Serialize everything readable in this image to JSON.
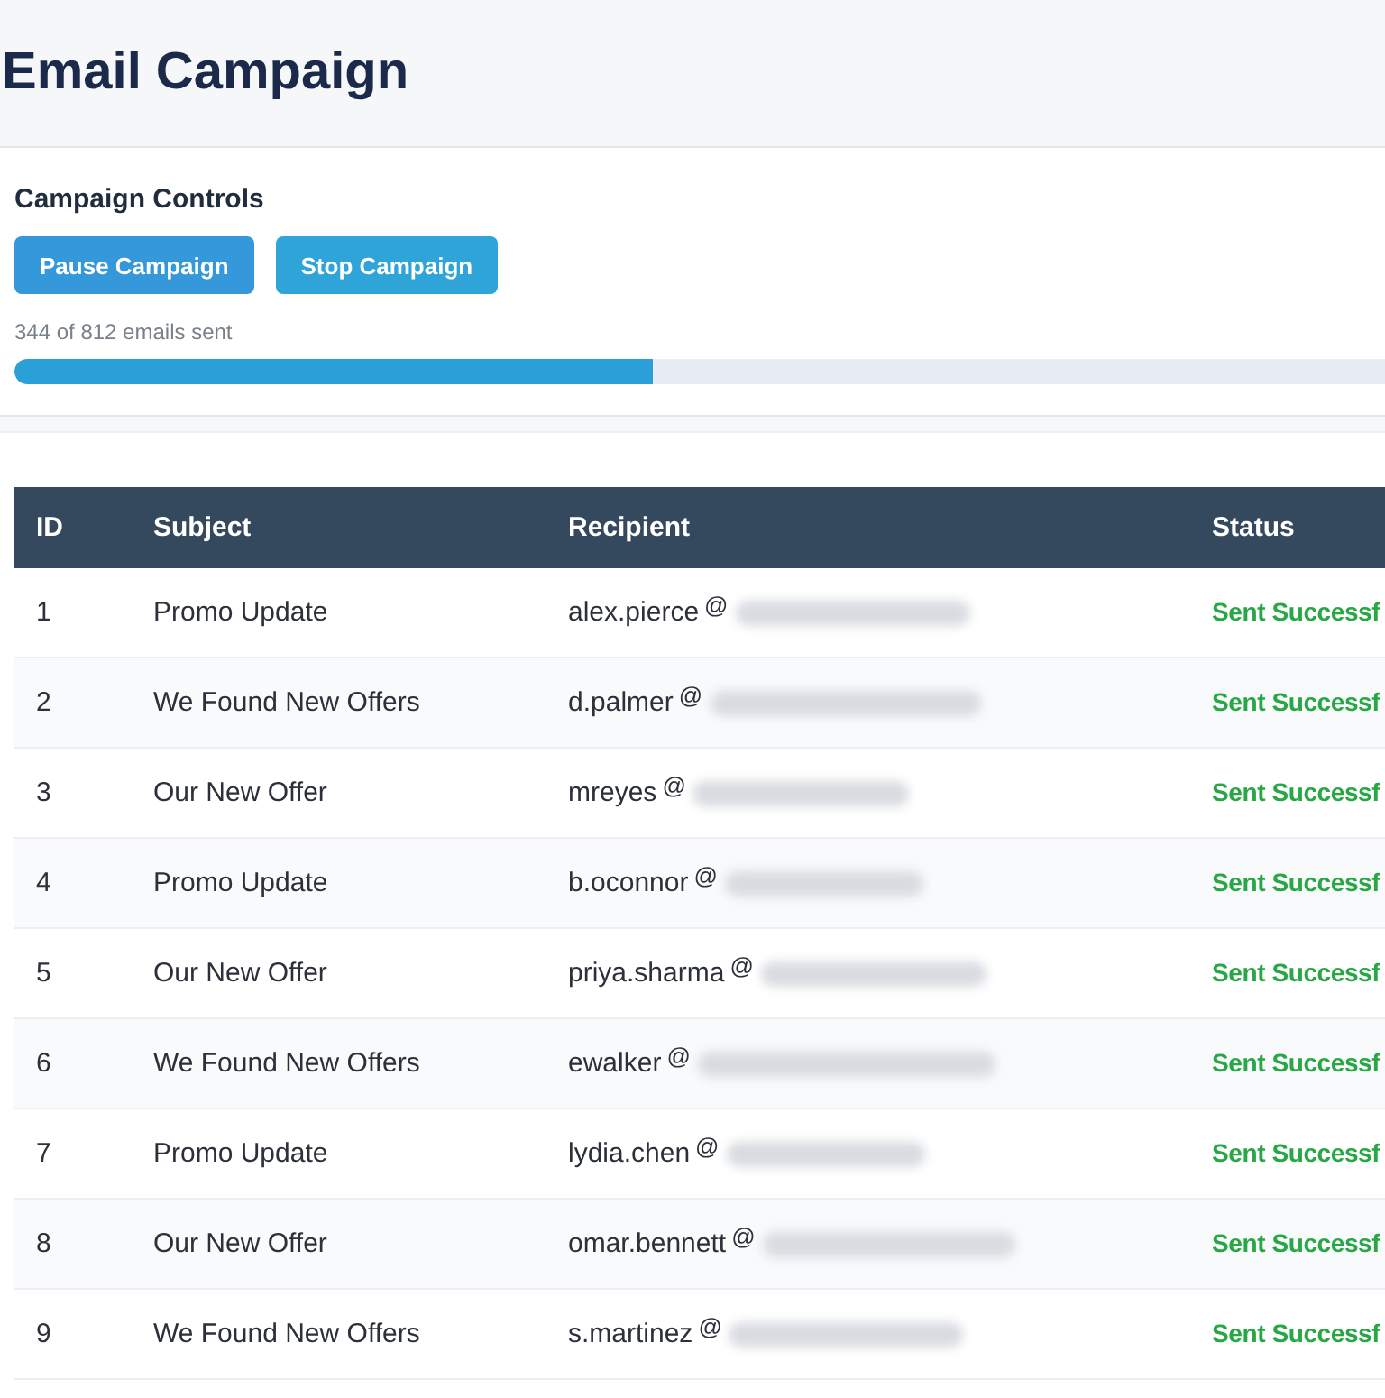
{
  "title": "Email Campaign",
  "controls": {
    "heading": "Campaign Controls",
    "buttons": [
      {
        "label": "Pause Campaign",
        "kind": "pause"
      },
      {
        "label": "Stop Campaign",
        "kind": "stop"
      }
    ],
    "progress_text": "344 of 812 emails sent",
    "level": 0.424
  },
  "table": {
    "columns": [
      "ID",
      "Subject",
      "Recipient",
      "Status"
    ],
    "rows": [
      {
        "id": "1",
        "subject": "Promo Update",
        "recipient": "alex.pierce",
        "at": "@",
        "status": "Sent Successf"
      },
      {
        "id": "2",
        "subject": "We Found New Offers",
        "recipient": "d.palmer",
        "at": "@",
        "status": "Sent Successf"
      },
      {
        "id": "3",
        "subject": "Our New Offer",
        "recipient": "mreyes",
        "at": "@",
        "status": "Sent Successf"
      },
      {
        "id": "4",
        "subject": "Promo Update",
        "recipient": "b.oconnor",
        "at": "@",
        "status": "Sent Successf"
      },
      {
        "id": "5",
        "subject": "Our New Offer",
        "recipient": "priya.sharma",
        "at": "@",
        "status": "Sent Successf"
      },
      {
        "id": "6",
        "subject": "We Found New Offers",
        "recipient": "ewalker",
        "at": "@",
        "status": "Sent Successf"
      },
      {
        "id": "7",
        "subject": "Promo Update",
        "recipient": "lydia.chen",
        "at": "@",
        "status": "Sent Successf"
      },
      {
        "id": "8",
        "subject": "Our New Offer",
        "recipient": "omar.bennett",
        "at": "@",
        "status": "Sent Successf"
      },
      {
        "id": "9",
        "subject": "We Found New Offers",
        "recipient": "s.martinez",
        "at": "@",
        "status": "Sent Successf"
      }
    ]
  }
}
